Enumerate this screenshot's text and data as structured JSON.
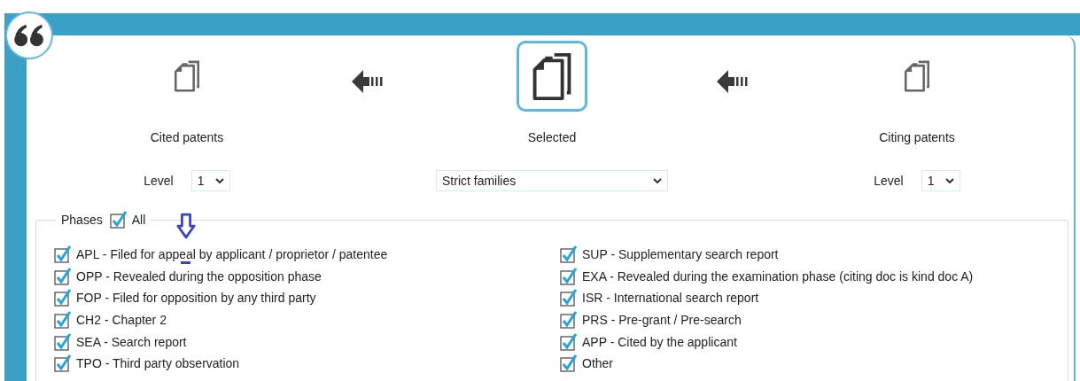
{
  "nodes": [
    {
      "kind": "level",
      "label": "Cited patents",
      "selected": false,
      "field_label": "Level",
      "value": "1"
    },
    {
      "kind": "dropdown",
      "label": "Selected",
      "selected": true,
      "value": "Strict families"
    },
    {
      "kind": "level",
      "label": "Citing patents",
      "selected": false,
      "field_label": "Level",
      "value": "1"
    }
  ],
  "phases": {
    "title": "Phases",
    "all_label": "All",
    "all_checked": true,
    "columns": [
      [
        {
          "label": "APL - Filed for appeal by applicant / proprietor / patentee",
          "checked": true
        },
        {
          "label": "OPP - Revealed during the opposition phase",
          "checked": true
        },
        {
          "label": "FOP - Filed for opposition by any third party",
          "checked": true
        },
        {
          "label": "CH2 - Chapter 2",
          "checked": true
        },
        {
          "label": "SEA - Search report",
          "checked": true
        },
        {
          "label": "TPO - Third party observation",
          "checked": true
        }
      ],
      [
        {
          "label": "SUP - Supplementary search report",
          "checked": true
        },
        {
          "label": "EXA - Revealed during the examination phase (citing doc is kind doc A)",
          "checked": true
        },
        {
          "label": "ISR - International search report",
          "checked": true
        },
        {
          "label": "PRS - Pre-grant / Pre-search",
          "checked": true
        },
        {
          "label": "APP - Cited by the applicant",
          "checked": true
        },
        {
          "label": "Other",
          "checked": true
        }
      ]
    ]
  }
}
